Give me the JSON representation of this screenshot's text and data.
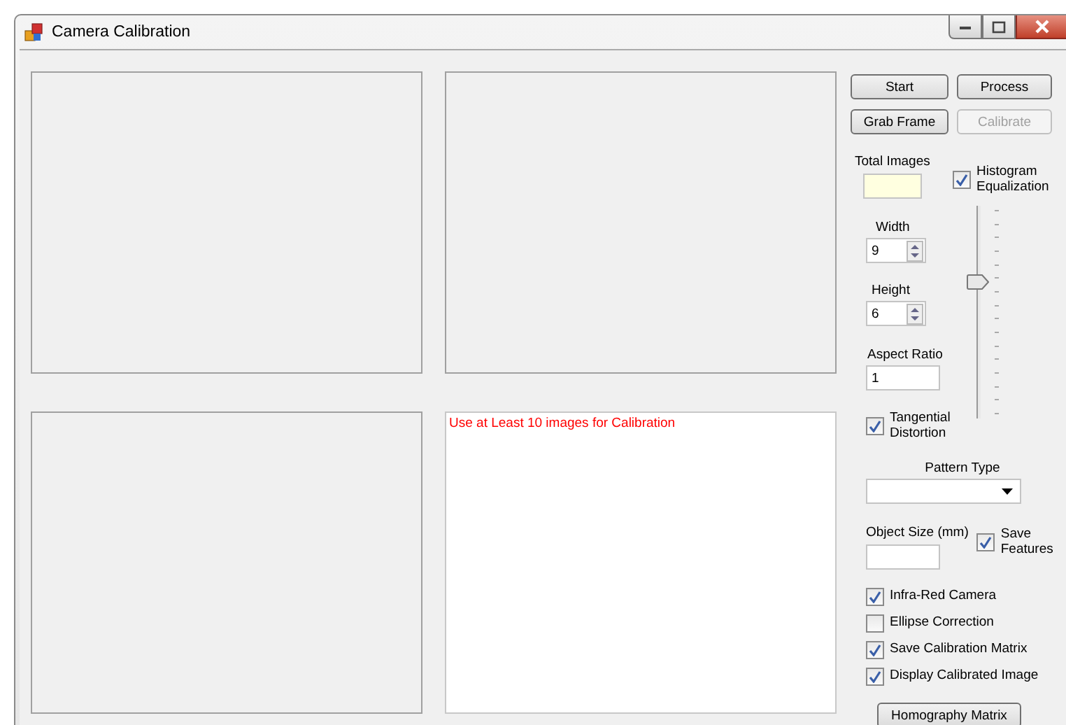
{
  "window": {
    "title": "Camera Calibration"
  },
  "buttons_top": [
    {
      "label": "Start",
      "disabled": false
    },
    {
      "label": "Process",
      "disabled": false
    },
    {
      "label": "Grab Frame",
      "disabled": false
    },
    {
      "label": "Calibrate",
      "disabled": true
    }
  ],
  "total_images": {
    "label": "Total Images"
  },
  "histogram_equalization": {
    "label": "Histogram Equalization",
    "checked": true
  },
  "width": {
    "label": "Width",
    "value": "9"
  },
  "height": {
    "label": "Height",
    "value": "6"
  },
  "aspect_ratio": {
    "label": "Aspect Ratio",
    "value": "1"
  },
  "tangential_distortion": {
    "label": "Tangential Distortion",
    "checked": true
  },
  "slider": {
    "level": 0.65
  },
  "pattern_type": {
    "label": "Pattern Type"
  },
  "object_size": {
    "label": "Object Size (mm)"
  },
  "save_features": {
    "label": "Save Features",
    "checked": true
  },
  "options": [
    {
      "label": "Infra-Red Camera",
      "checked": true
    },
    {
      "label": "Ellipse Correction",
      "checked": false
    },
    {
      "label": "Save Calibration Matrix",
      "checked": true
    },
    {
      "label": "Display Calibrated Image",
      "checked": true
    }
  ],
  "homography_button": {
    "label": "Homography Matrix"
  },
  "log": {
    "text": "Use at Least 10 images for Calibration",
    "color": "#ff0000"
  }
}
